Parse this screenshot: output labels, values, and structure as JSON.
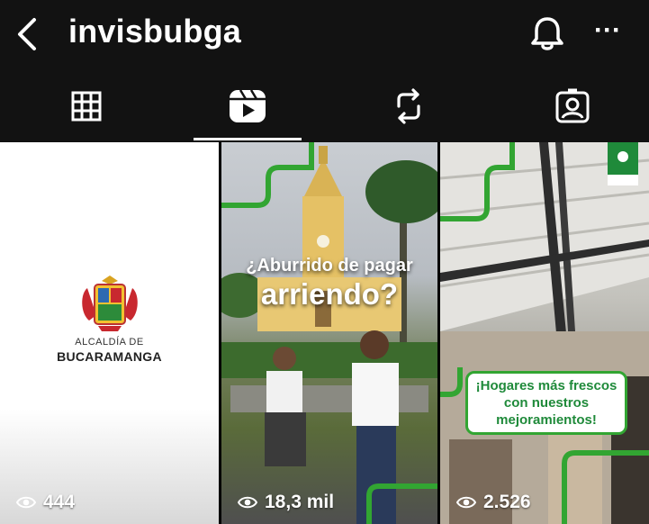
{
  "header": {
    "username": "invisbubga",
    "back_icon": "chevron-left-icon",
    "bell_icon": "bell-icon",
    "more_icon": "more-horizontal-icon",
    "more_glyph": "···"
  },
  "tabs": [
    {
      "name": "grid",
      "icon": "grid-icon",
      "selected": false
    },
    {
      "name": "reels",
      "icon": "reels-icon",
      "selected": true
    },
    {
      "name": "reposts",
      "icon": "repost-icon",
      "selected": false
    },
    {
      "name": "tagged",
      "icon": "tagged-icon",
      "selected": false
    }
  ],
  "reels": [
    {
      "logo_line1": "ALCALDÍA DE",
      "logo_line2": "BUCARAMANGA",
      "views": "444"
    },
    {
      "headline_line1": "¿Aburrido de pagar",
      "headline_line2": "arriendo?",
      "views": "18,3 mil"
    },
    {
      "callout_line1": "¡Hogares más frescos",
      "callout_line2": "con nuestros",
      "callout_line3": "mejoramientos!",
      "views": "2.526"
    }
  ],
  "colors": {
    "bar_background": "#121212",
    "accent_green": "#32a532",
    "brand_green": "#1f8a3a"
  }
}
